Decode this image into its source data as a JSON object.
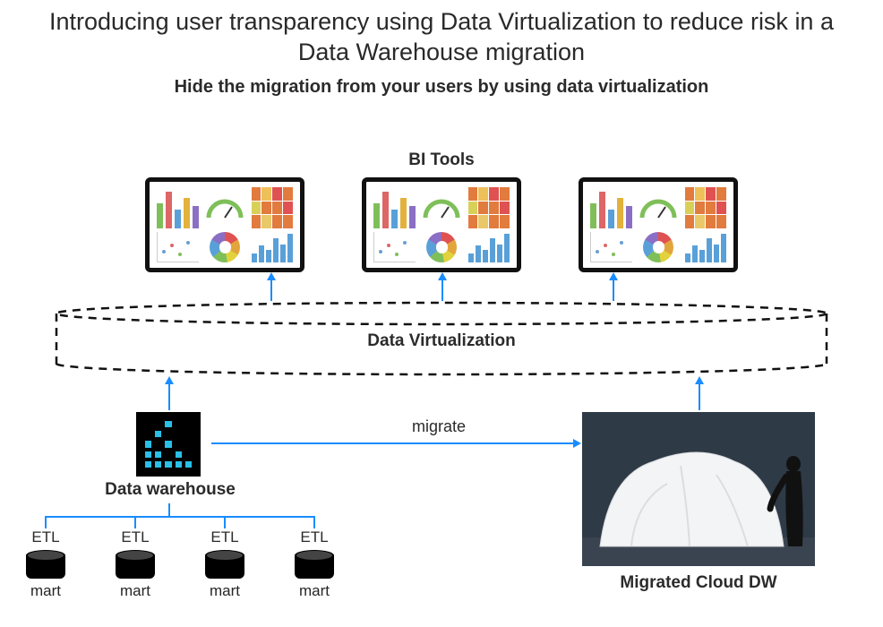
{
  "title": "Introducing user transparency using Data Virtualization to reduce risk in a Data Warehouse migration",
  "subtitle": "Hide the migration from your users by using data virtualization",
  "labels": {
    "bi_tools": "BI Tools",
    "data_virtualization": "Data Virtualization",
    "data_warehouse": "Data warehouse",
    "migrate": "migrate",
    "migrated_cloud_dw": "Migrated Cloud DW"
  },
  "etl_columns": [
    {
      "process": "ETL",
      "store": "mart"
    },
    {
      "process": "ETL",
      "store": "mart"
    },
    {
      "process": "ETL",
      "store": "mart"
    },
    {
      "process": "ETL",
      "store": "mart"
    }
  ]
}
